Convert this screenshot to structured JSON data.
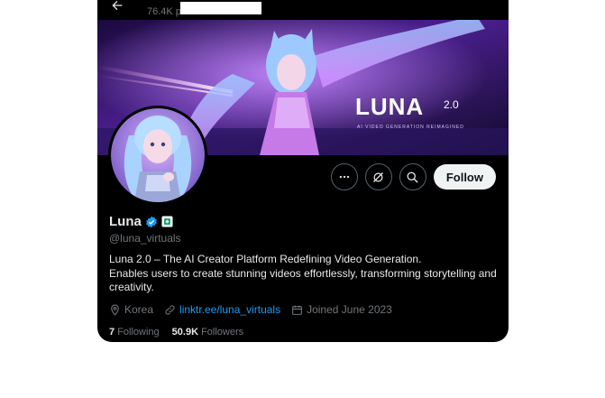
{
  "header": {
    "posts_count": "76.4K posts"
  },
  "banner": {
    "logo_text": "LUNA",
    "logo_version": "2.0",
    "tagline": "AI VIDEO GENERATION   REIMAGINED"
  },
  "actions": {
    "follow_label": "Follow"
  },
  "profile": {
    "name": "Luna",
    "handle": "@luna_virtuals",
    "bio_line1": "Luna 2.0 – The AI Creator Platform Redefining Video Generation.",
    "bio_line2": "Enables users to create stunning videos effortlessly, transforming storytelling and creativity.",
    "location": "Korea",
    "link": "linktr.ee/luna_virtuals",
    "joined": "Joined June 2023"
  },
  "stats": {
    "following_count": "7",
    "following_label": "Following",
    "followers_count": "50.9K",
    "followers_label": "Followers"
  },
  "colors": {
    "accent": "#1d9bf0",
    "verified": "#1d9bf0",
    "background": "#000000"
  }
}
